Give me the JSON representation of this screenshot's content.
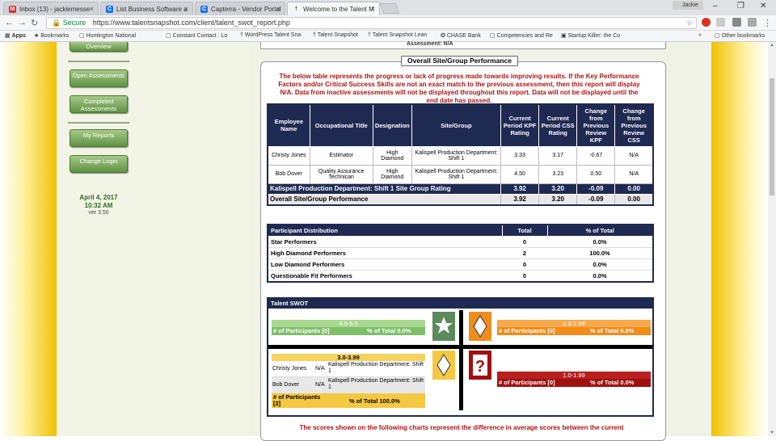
{
  "browser": {
    "tabs": [
      {
        "title": "Inbox (13) - jackiemesse",
        "icon": "gmail-icon"
      },
      {
        "title": "List Business Software a",
        "icon": "capterra-icon"
      },
      {
        "title": "Capterra - Vendor Portal",
        "icon": "capterra-icon"
      },
      {
        "title": "Welcome to the Talent M",
        "icon": "talent-icon"
      }
    ],
    "profile": "Jackie",
    "secure_label": "Secure",
    "url": "https://www.talentsnapshot.com/client/talent_swot_report.php",
    "bookmarks": [
      "Apps",
      "Bookmarks",
      "Huntington National",
      "Constant Contact : Lo",
      "WordPress Talent Sna",
      "Talent Snapshot",
      "Talent Snapshot Lean",
      "CHASE Bank",
      "Competencies and Re",
      "Startup Killer: the Co"
    ],
    "other_bookmarks": "Other bookmarks"
  },
  "sidebar": {
    "buttons": [
      "Overview",
      "Open Assessments",
      "Completed Assessments",
      "My Reports",
      "Change Login"
    ],
    "date": "April 4, 2017",
    "time": "10:32 AM",
    "version": "ver 3.50"
  },
  "report": {
    "prev_text": "Assessment:  N/A",
    "panel_title": "Overall Site/Group Performance",
    "note": "The below table represents the progress or lack of progress made towards improving results. If the Key Performance Factors and/or Critical Success Skills are not an exact match to the previous assessment, then this report will display N/A. Data from inactive assessments will not be displayed throughout this report. Data will not be displayed until the end date has passed.",
    "headers": [
      "Employee Name",
      "Occupational Title",
      "Designation",
      "Site/Group",
      "Current Period KPF Rating",
      "Current Period CSS Rating",
      "Change from Previous Review KPF",
      "Change from Previous Review CSS"
    ],
    "rows": [
      [
        "Christy Jones",
        "Estimator",
        "High Diamond",
        "Kalispell Production Department: Shift 1",
        "3.33",
        "3.17",
        "-0.67",
        "N/A"
      ],
      [
        "Bob Dover",
        "Quality Assurance Technican",
        "High Diamond",
        "Kalispell Production Department: Shift 1",
        "4.50",
        "3.23",
        "0.50",
        "N/A"
      ]
    ],
    "site_rating": {
      "label": "Kalispell Production Department: Shift 1 Site Group Rating",
      "kpf": "3.92",
      "css": "3.20",
      "kpf_change": "-0.09",
      "css_change": "0.00"
    },
    "overall": {
      "label": "Overall Site/Group Performance",
      "kpf": "3.92",
      "css": "3.20",
      "kpf_change": "-0.09",
      "css_change": "0.00"
    }
  },
  "distribution": {
    "headers": [
      "Participant Distribution",
      "Total",
      "% of Total"
    ],
    "rows": [
      [
        "Star Performers",
        "0",
        "0.0%"
      ],
      [
        "High Diamond Performers",
        "2",
        "100.0%"
      ],
      [
        "Low Diamond Performers",
        "0",
        "0.0%"
      ],
      [
        "Questionable Fit Performers",
        "0",
        "0.0%"
      ]
    ]
  },
  "swot": {
    "title": "Talent SWOT",
    "q1": {
      "range": "4.0-5.0",
      "participants": "# of Participants [0]",
      "pct": "% of Total 0.0%",
      "color": "#7fbf6a",
      "head_color": "#a8d890"
    },
    "q2": {
      "range": "2.0-2.99",
      "participants": "# of Participants [0]",
      "pct": "% of Total 0.0%",
      "color": "#f08c1a",
      "head_color": "#f6a84a"
    },
    "q3": {
      "range": "3.0-3.99",
      "participants": "# of Participants [2]",
      "pct": "% of Total 100.0%",
      "color": "#f5c842",
      "head_color": "#f7d25e",
      "people": [
        [
          "Christy Jones",
          "N/A",
          "Kalispell Production Department: Shift 1"
        ],
        [
          "Bob Dover",
          "N/A",
          "Kalispell Production Department: Shift 1"
        ]
      ]
    },
    "q4": {
      "range": "1.0-1.99",
      "participants": "# of Participants [0]",
      "pct": "% of Total 0.0%",
      "color": "#a01010",
      "head_color": "#b82020"
    }
  },
  "bottom_note": "The scores shown on the following charts represent the difference in average scores between the current"
}
